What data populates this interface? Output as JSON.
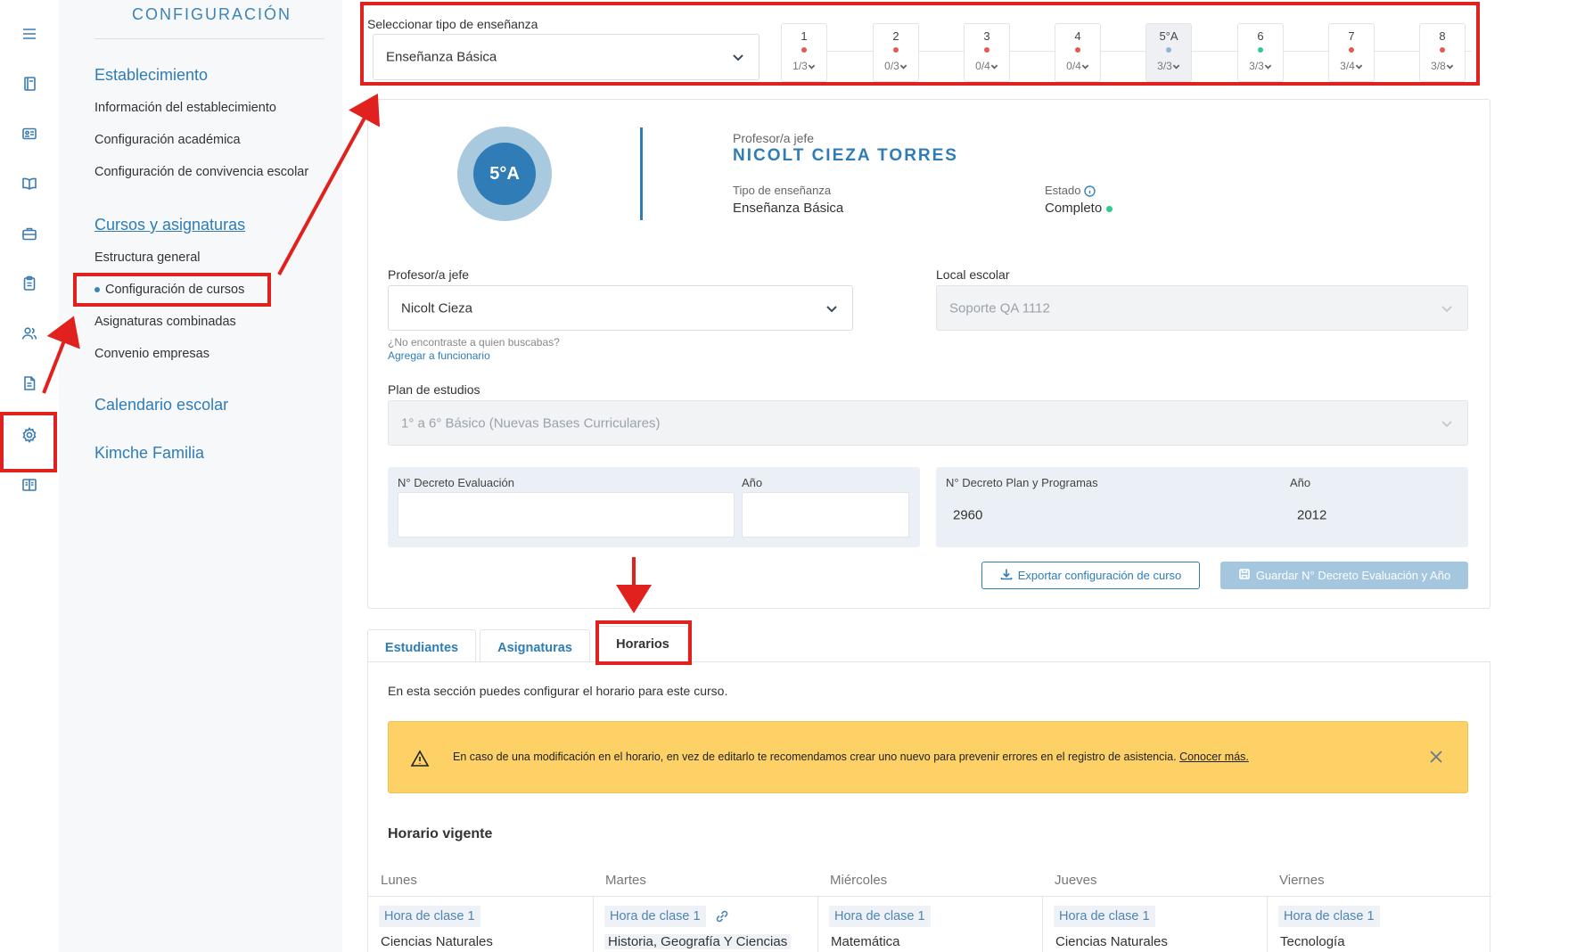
{
  "rail": {
    "icons": [
      "menu-icon",
      "notebook-icon",
      "id-card-icon",
      "book-open-icon",
      "briefcase-icon",
      "clipboard-icon",
      "users-icon",
      "document-icon",
      "gear-icon",
      "book-icon"
    ]
  },
  "sidebar": {
    "title": "CONFIGURACIÓN",
    "sections": [
      {
        "label": "Establecimiento",
        "items": [
          "Información del establecimiento",
          "Configuración académica",
          "Configuración de convivencia escolar"
        ]
      },
      {
        "label": "Cursos y asignaturas",
        "items": [
          "Estructura general",
          "Configuración de cursos",
          "Asignaturas combinadas",
          "Convenio empresas"
        ]
      },
      {
        "label": "Calendario escolar",
        "items": []
      },
      {
        "label": "Kimche Familia",
        "items": []
      }
    ]
  },
  "teaching_type": {
    "label": "Seleccionar tipo de enseñanza",
    "value": "Enseñanza Básica"
  },
  "courses": [
    {
      "name": "1",
      "count": "1/3",
      "status": "red"
    },
    {
      "name": "2",
      "count": "0/3",
      "status": "red"
    },
    {
      "name": "3",
      "count": "0/4",
      "status": "red"
    },
    {
      "name": "4",
      "count": "0/4",
      "status": "red"
    },
    {
      "name": "5°A",
      "count": "3/3",
      "status": "blue"
    },
    {
      "name": "6",
      "count": "3/3",
      "status": "green"
    },
    {
      "name": "7",
      "count": "3/4",
      "status": "red"
    },
    {
      "name": "8",
      "count": "3/8",
      "status": "red"
    }
  ],
  "course_card": {
    "avatar": "5°A",
    "head_teacher_label": "Profesor/a jefe",
    "head_teacher_name": "NICOLT CIEZA TORRES",
    "teaching_type_label": "Tipo de enseñanza",
    "teaching_type_value": "Enseñanza Básica",
    "status_label": "Estado",
    "status_value": "Completo"
  },
  "form": {
    "teacher_label": "Profesor/a jefe",
    "teacher_value": "Nicolt Cieza",
    "not_found_hint": "¿No encontraste a quien buscabas?",
    "add_staff_link": "Agregar a funcionario",
    "local_label": "Local escolar",
    "local_value": "Soporte QA 1112",
    "plan_label": "Plan de estudios",
    "plan_value": "1° a 6° Básico (Nuevas Bases Curriculares)",
    "decree_eval_label": "N° Decreto Evaluación",
    "decree_eval_value": "",
    "year_label": "Año",
    "year_eval_value": "",
    "decree_plan_label": "N° Decreto Plan y Programas",
    "decree_plan_value": "2960",
    "year_plan_value": "2012",
    "export_button": "Exportar configuración de curso",
    "save_button": "Guardar N° Decreto Evaluación y Año"
  },
  "tabs": [
    "Estudiantes",
    "Asignaturas",
    "Horarios"
  ],
  "schedule": {
    "intro": "En esta sección puedes configurar el horario para este curso.",
    "warning": "En caso de una modificación en el horario, en vez de editarlo te recomendamos crear uno nuevo para prevenir errores en el registro de asistencia.",
    "warning_link": "Conocer más.",
    "title": "Horario vigente",
    "days": [
      {
        "name": "Lunes",
        "slot": "Hora de clase 1",
        "subject": "Ciencias Naturales"
      },
      {
        "name": "Martes",
        "slot": "Hora de clase 1",
        "subject": "Historia, Geografía Y Ciencias"
      },
      {
        "name": "Miércoles",
        "slot": "Hora de clase 1",
        "subject": "Matemática"
      },
      {
        "name": "Jueves",
        "slot": "Hora de clase 1",
        "subject": "Ciencias Naturales"
      },
      {
        "name": "Viernes",
        "slot": "Hora de clase 1",
        "subject": "Tecnología"
      }
    ]
  },
  "colors": {
    "accent": "#2f7cb6",
    "warning": "#fdd166",
    "annotation": "#e0211d",
    "status_red": "#e05a4f",
    "status_green": "#2ecc8f",
    "status_blue": "#8fb6d6"
  }
}
